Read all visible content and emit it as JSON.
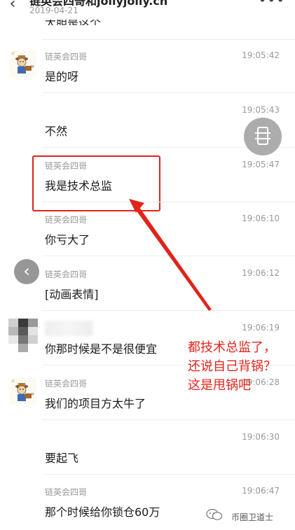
{
  "header": {
    "title": "链英会四哥和jollyjolly.cn",
    "date": "2019-04-21",
    "back_icon": "chevron-left-icon",
    "more_icon": "more-dots-icon"
  },
  "partial_message": "大胆是这个",
  "messages": [
    {
      "name": "链英会四哥",
      "time": "19:05:42",
      "text": "是的呀",
      "avatar": true
    },
    {
      "name": "",
      "time": "19:05:43",
      "text": "不然",
      "avatar": false
    },
    {
      "name": "链英会四哥",
      "time": "19:05:47",
      "text": "我是技术总监",
      "avatar": false
    },
    {
      "name": "链英会四哥",
      "time": "19:06:10",
      "text": "你亏大了",
      "avatar": false
    },
    {
      "name": "链英会四哥",
      "time": "19:06:12",
      "text": "[动画表情]",
      "avatar": false
    },
    {
      "name": "",
      "time": "19:06:19",
      "text": "你那时候是不是很便宜",
      "avatar": false
    },
    {
      "name": "链英会四哥",
      "time": "19:06:28",
      "text": "我们的项目方太牛了",
      "avatar": true
    },
    {
      "name": "",
      "time": "19:06:30",
      "text": "要起飞",
      "avatar": false
    },
    {
      "name": "链英会四哥",
      "time": "19:06:47",
      "text": "那个时候给你锁仓60万",
      "avatar": false
    }
  ],
  "annotation": {
    "lines": [
      "都技术总监了，",
      "还说自己背锅？",
      "这是甩锅吧"
    ],
    "color": "#e0241a"
  },
  "watermark": {
    "text": "币圈卫道士",
    "icon": "wechat-icon"
  },
  "colors": {
    "accent_red": "#e0241a",
    "meta_gray": "#999999"
  }
}
